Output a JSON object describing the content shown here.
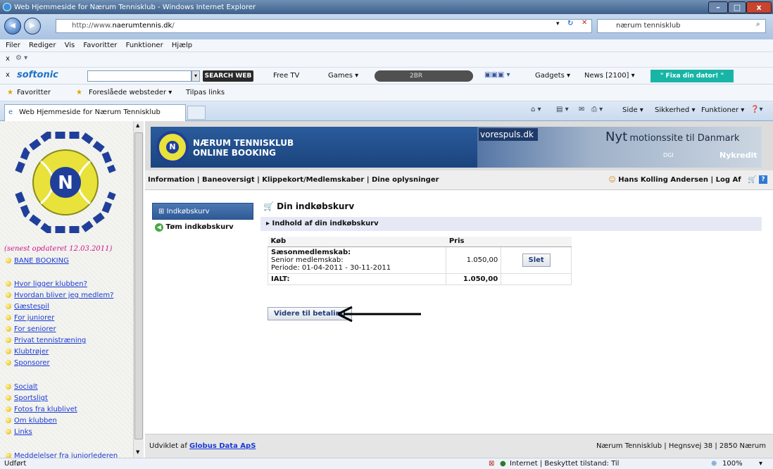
{
  "window": {
    "title": "Web Hjemmeside for Nærum Tennisklub - Windows Internet Explorer"
  },
  "address": {
    "prefix": "http://www.",
    "domain": "naerumtennis.dk",
    "suffix": "/",
    "search_value": "nærum tennisklub"
  },
  "menu": [
    "Filer",
    "Rediger",
    "Vis",
    "Favoritter",
    "Funktioner",
    "Hjælp"
  ],
  "softonic_bar": {
    "brand": "softonic",
    "search_label": "SEARCH WEB",
    "freetv": "Free TV",
    "games": "Games",
    "radio": "2BR",
    "gadgets": "Gadgets",
    "news": "News [2100]",
    "fix": "\" Fixa din dator! \""
  },
  "favorites_bar": {
    "favorites": "Favoritter",
    "suggested": "Foreslåede websteder ▾",
    "custom": "Tilpas links"
  },
  "tab": {
    "label": "Web Hjemmeside for Nærum Tennisklub"
  },
  "ie_commands": [
    "Side ▾",
    "Sikkerhed ▾",
    "Funktioner ▾"
  ],
  "left": {
    "updated": "(senest opdateret 12.03.2011)",
    "links": [
      "BANE BOOKING",
      "Hvor ligger klubben?",
      "Hvordan bliver jeg medlem?",
      "Gæstespil",
      "For juniorer",
      "For seniorer",
      "Privat tennistræning",
      "Klubtrøjer",
      "Sponsorer",
      "Socialt",
      "Sportsligt",
      "Fotos fra klublivet",
      "Om klubben",
      "Links",
      "Meddelelser fra juniorlederen"
    ]
  },
  "header": {
    "title1": "NÆRUM TENNISKLUB",
    "title2": "ONLINE BOOKING",
    "ad_brand": "vorespuls.dk",
    "ad_text_big": "Nyt",
    "ad_text": "motionssite til Danmark",
    "ad_sponsor": "Nykredit",
    "ad_small": "DGI"
  },
  "nav": {
    "links": "Information | Baneoversigt | Klippekort/Medlemskaber | Dine oplysninger",
    "user": "Hans Kolling Andersen | Log Af"
  },
  "sidebar": {
    "basket": "Indkøbskurv",
    "empty": "Tøm indkøbskurv"
  },
  "cart": {
    "title": "Din indkøbskurv",
    "subtitle": "Indhold af din indkøbskurv",
    "col_item": "Køb",
    "col_price": "Pris",
    "item_title": "Sæsonmedlemskab:",
    "item_line1": "Senior medlemskab:",
    "item_line2": "Periode: 01-04-2011 - 30-11-2011",
    "item_price": "1.050,00",
    "delete": "Slet",
    "total_label": "IALT:",
    "total_value": "1.050,00",
    "checkout": "Videre til betaling"
  },
  "footer": {
    "prefix": "Udviklet af",
    "link": "Globus Data ApS",
    "address": "Nærum Tennisklub | Hegnsvej 38 | 2850 Nærum"
  },
  "status": {
    "left": "Udført",
    "zone": "Internet | Beskyttet tilstand: Til",
    "zoom": "100%"
  }
}
